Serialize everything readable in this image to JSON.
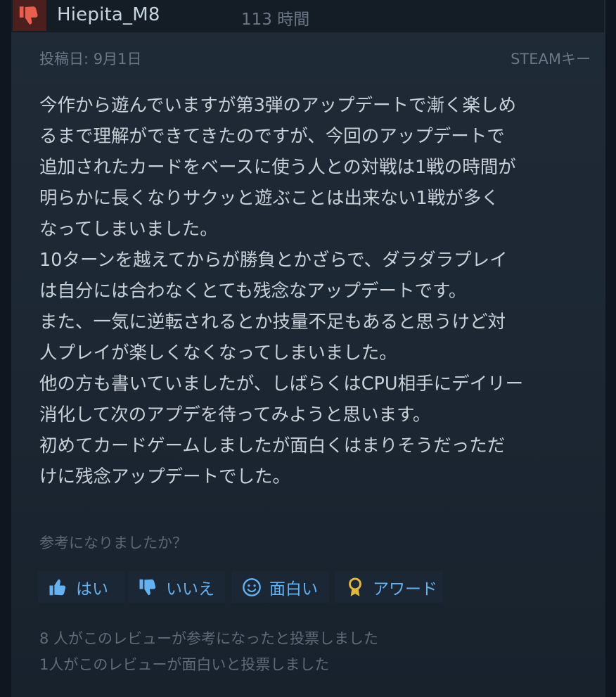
{
  "review": {
    "username": "Hiepita_M8",
    "hours": "113 時間",
    "posted": "投稿日: 9月1日",
    "key": "STEAMキー",
    "lines": [
      "今作から遊んでいますが第3弾のアップデートで漸く楽しめ",
      "るまで理解ができてきたのですが、今回のアップデートで",
      "追加されたカードをベースに使う人との対戦は1戦の時間が",
      "明らかに長くなりサクッと遊ぶことは出来ない1戦が多く",
      "なってしまいました。",
      "10ターンを越えてからが勝負とかざらで、ダラダラプレイ",
      "は自分には合わなくとても残念なアップデートです。",
      "また、一気に逆転されるとか技量不足もあると思うけど対",
      "人プレイが楽しくなくなってしまいました。",
      "他の方も書いていましたが、しばらくはCPU相手にデイリー",
      "消化して次のアプデを待ってみようと思います。",
      "初めてカードゲームしましたが面白くはまりそうだっただ",
      "けに残念アップデートでした。"
    ]
  },
  "feedback": {
    "question": "参考になりましたか？",
    "yes": "はい",
    "no": "いいえ",
    "funny": "面白い",
    "award": "アワード",
    "helpful_count": "8 人がこのレビューが参考になったと投票しました",
    "funny_count": "1人がこのレビューが面白いと投票しました"
  },
  "icons": {
    "thumb_down_badge": "thumbs-down-icon",
    "yes": "thumbs-up-icon",
    "no": "thumbs-down-icon",
    "funny": "smiley-icon",
    "award": "award-ribbon-icon"
  },
  "colors": {
    "badge_bg": "#4a1f1d",
    "badge_icon": "#e85f4e",
    "button_text": "#66b2f0",
    "award_gold": "#e2b845"
  }
}
